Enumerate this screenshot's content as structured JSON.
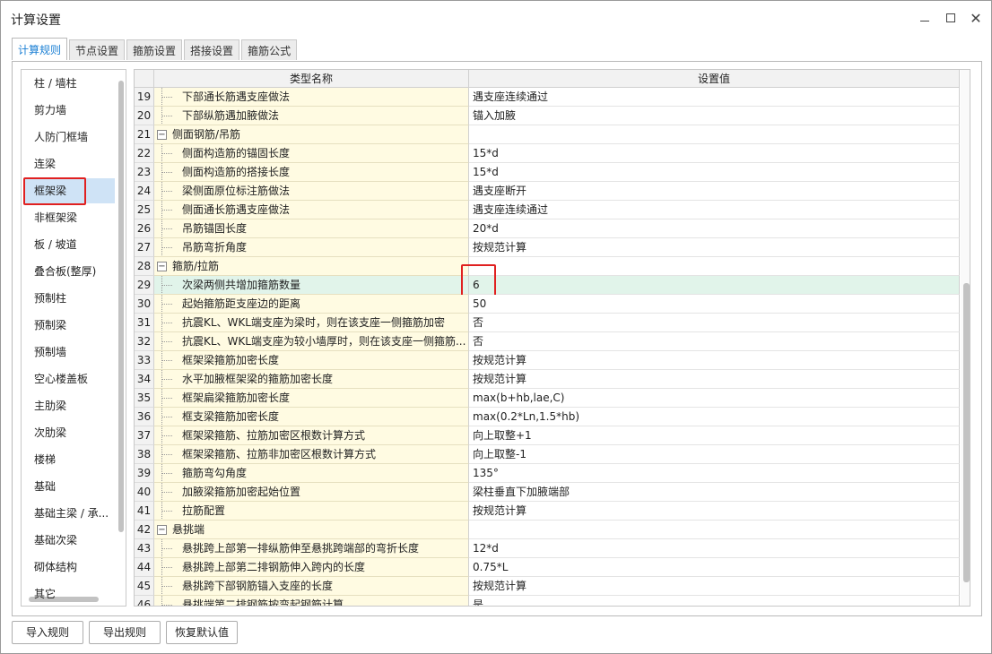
{
  "window": {
    "title": "计算设置",
    "min_icon": "minimize-icon",
    "max_icon": "maximize-icon",
    "close_symbol": "✕"
  },
  "tabs": [
    {
      "label": "计算规则",
      "active": true
    },
    {
      "label": "节点设置",
      "active": false
    },
    {
      "label": "箍筋设置",
      "active": false
    },
    {
      "label": "搭接设置",
      "active": false
    },
    {
      "label": "箍筋公式",
      "active": false
    }
  ],
  "sidebar": {
    "items": [
      {
        "label": "柱 / 墙柱"
      },
      {
        "label": "剪力墙"
      },
      {
        "label": "人防门框墙"
      },
      {
        "label": "连梁"
      },
      {
        "label": "框架梁",
        "selected": true
      },
      {
        "label": "非框架梁"
      },
      {
        "label": "板 / 坡道"
      },
      {
        "label": "叠合板(整厚)"
      },
      {
        "label": "预制柱"
      },
      {
        "label": "预制梁"
      },
      {
        "label": "预制墙"
      },
      {
        "label": "空心楼盖板"
      },
      {
        "label": "主肋梁"
      },
      {
        "label": "次肋梁"
      },
      {
        "label": "楼梯"
      },
      {
        "label": "基础"
      },
      {
        "label": "基础主梁 / 承..."
      },
      {
        "label": "基础次梁"
      },
      {
        "label": "砌体结构"
      },
      {
        "label": "其它"
      }
    ]
  },
  "grid": {
    "header": {
      "name": "类型名称",
      "value": "设置值"
    },
    "rows": [
      {
        "num": "19",
        "name": "下部通长筋遇支座做法",
        "value": "遇支座连续通过"
      },
      {
        "num": "20",
        "name": "下部纵筋遇加腋做法",
        "value": "锚入加腋"
      },
      {
        "num": "21",
        "name": "侧面钢筋/吊筋",
        "value": "",
        "group": true
      },
      {
        "num": "22",
        "name": "侧面构造筋的锚固长度",
        "value": "15*d"
      },
      {
        "num": "23",
        "name": "侧面构造筋的搭接长度",
        "value": "15*d"
      },
      {
        "num": "24",
        "name": "梁侧面原位标注筋做法",
        "value": "遇支座断开"
      },
      {
        "num": "25",
        "name": "侧面通长筋遇支座做法",
        "value": "遇支座连续通过"
      },
      {
        "num": "26",
        "name": "吊筋锚固长度",
        "value": "20*d"
      },
      {
        "num": "27",
        "name": "吊筋弯折角度",
        "value": "按规范计算"
      },
      {
        "num": "28",
        "name": "箍筋/拉筋",
        "value": "",
        "group": true
      },
      {
        "num": "29",
        "name": "次梁两侧共增加箍筋数量",
        "value": "6",
        "selected": true
      },
      {
        "num": "30",
        "name": "起始箍筋距支座边的距离",
        "value": "50"
      },
      {
        "num": "31",
        "name": "抗震KL、WKL端支座为梁时，则在该支座一侧箍筋加密",
        "value": "否"
      },
      {
        "num": "32",
        "name": "抗震KL、WKL端支座为较小墙厚时，则在该支座一侧箍筋...",
        "value": "否"
      },
      {
        "num": "33",
        "name": "框架梁箍筋加密长度",
        "value": "按规范计算"
      },
      {
        "num": "34",
        "name": "水平加腋框架梁的箍筋加密长度",
        "value": "按规范计算"
      },
      {
        "num": "35",
        "name": "框架扁梁箍筋加密长度",
        "value": "max(b+hb,lae,C)"
      },
      {
        "num": "36",
        "name": "框支梁箍筋加密长度",
        "value": "max(0.2*Ln,1.5*hb)"
      },
      {
        "num": "37",
        "name": "框架梁箍筋、拉筋加密区根数计算方式",
        "value": "向上取整+1"
      },
      {
        "num": "38",
        "name": "框架梁箍筋、拉筋非加密区根数计算方式",
        "value": "向上取整-1"
      },
      {
        "num": "39",
        "name": "箍筋弯勾角度",
        "value": "135°"
      },
      {
        "num": "40",
        "name": "加腋梁箍筋加密起始位置",
        "value": "梁柱垂直下加腋端部"
      },
      {
        "num": "41",
        "name": "拉筋配置",
        "value": "按规范计算"
      },
      {
        "num": "42",
        "name": "悬挑端",
        "value": "",
        "group": true
      },
      {
        "num": "43",
        "name": "悬挑跨上部第一排纵筋伸至悬挑跨端部的弯折长度",
        "value": "12*d"
      },
      {
        "num": "44",
        "name": "悬挑跨上部第二排钢筋伸入跨内的长度",
        "value": "0.75*L"
      },
      {
        "num": "45",
        "name": "悬挑跨下部钢筋锚入支座的长度",
        "value": "按规范计算"
      },
      {
        "num": "46",
        "name": "悬挑端第二排钢筋按弯起钢筋计算",
        "value": "是"
      }
    ]
  },
  "buttons": {
    "import": "导入规则",
    "export": "导出规则",
    "restore": "恢复默认值"
  },
  "colors": {
    "highlight_border": "#e02020",
    "selected_row": "#e1f4ea",
    "name_cell_bg": "#fffbe2",
    "sidebar_selected": "#cfe3f6",
    "active_tab_text": "#1a7fd4"
  }
}
